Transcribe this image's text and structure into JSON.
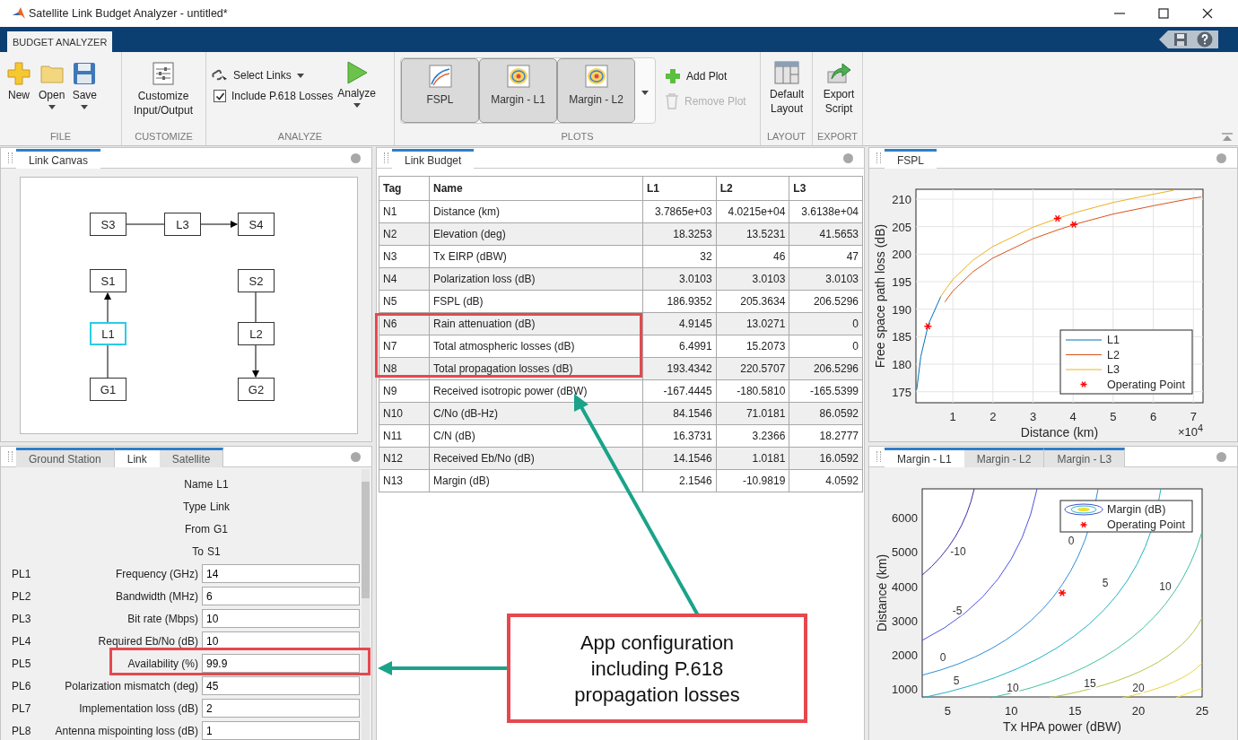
{
  "window": {
    "title": "Satellite Link Budget Analyzer - untitled*"
  },
  "ribbon_tabs": [
    {
      "label": "BUDGET ANALYZER",
      "selected": true
    }
  ],
  "toolstrip": {
    "file": {
      "label": "FILE",
      "buttons": [
        {
          "label": "New",
          "kind": "new",
          "caret": false
        },
        {
          "label": "Open",
          "kind": "open",
          "caret": true
        },
        {
          "label": "Save",
          "kind": "save",
          "caret": true
        }
      ]
    },
    "customize": {
      "label": "CUSTOMIZE",
      "button": "Customize Input/Output"
    },
    "analyze": {
      "label": "ANALYZE",
      "select_links": "Select Links",
      "include_p618": {
        "label": "Include P.618 Losses",
        "checked": true
      },
      "analyze_button": "Analyze"
    },
    "plots": {
      "label": "PLOTS",
      "gallery": [
        {
          "label": "FSPL",
          "kind": "fspl"
        },
        {
          "label": "Margin - L1",
          "kind": "margin"
        },
        {
          "label": "Margin - L2",
          "kind": "margin"
        }
      ],
      "add_plot": {
        "label": "Add Plot",
        "disabled": false
      },
      "remove_plot": {
        "label": "Remove Plot",
        "disabled": true
      }
    },
    "layout": {
      "label": "LAYOUT",
      "button": "Default Layout"
    },
    "export": {
      "label": "EXPORT",
      "button": "Export Script"
    }
  },
  "link_canvas": {
    "tab": "Link Canvas",
    "nodes": [
      {
        "label": "S3",
        "selected": false
      },
      {
        "label": "L3",
        "selected": false
      },
      {
        "label": "S4",
        "selected": false
      },
      {
        "label": "S1",
        "selected": false
      },
      {
        "label": "S2",
        "selected": false
      },
      {
        "label": "L1",
        "selected": true
      },
      {
        "label": "L2",
        "selected": false
      },
      {
        "label": "G1",
        "selected": false
      },
      {
        "label": "G2",
        "selected": false
      }
    ]
  },
  "properties": {
    "tabs": [
      {
        "label": "Ground Station",
        "selected": false
      },
      {
        "label": "Link",
        "selected": true
      },
      {
        "label": "Satellite",
        "selected": false
      }
    ],
    "info": [
      {
        "label": "Name",
        "value": "L1"
      },
      {
        "label": "Type",
        "value": "Link"
      },
      {
        "label": "From",
        "value": "G1"
      },
      {
        "label": "To",
        "value": "S1"
      }
    ],
    "params": [
      {
        "tag": "PL1",
        "label": "Frequency (GHz)",
        "value": "14"
      },
      {
        "tag": "PL2",
        "label": "Bandwidth (MHz)",
        "value": "6"
      },
      {
        "tag": "PL3",
        "label": "Bit rate (Mbps)",
        "value": "10"
      },
      {
        "tag": "PL4",
        "label": "Required Eb/No (dB)",
        "value": "10"
      },
      {
        "tag": "PL5",
        "label": "Availability (%)",
        "value": "99.9"
      },
      {
        "tag": "PL6",
        "label": "Polarization mismatch (deg)",
        "value": "45"
      },
      {
        "tag": "PL7",
        "label": "Implementation loss (dB)",
        "value": "2"
      },
      {
        "tag": "PL8",
        "label": "Antenna mispointing loss (dB)",
        "value": "1"
      }
    ]
  },
  "link_budget": {
    "tab": "Link Budget",
    "columns": [
      "Tag",
      "Name",
      "L1",
      "L2",
      "L3"
    ],
    "rows": [
      [
        "N1",
        "Distance (km)",
        "3.7865e+03",
        "4.0215e+04",
        "3.6138e+04"
      ],
      [
        "N2",
        "Elevation (deg)",
        "18.3253",
        "13.5231",
        "41.5653"
      ],
      [
        "N3",
        "Tx EIRP (dBW)",
        "32",
        "46",
        "47"
      ],
      [
        "N4",
        "Polarization loss (dB)",
        "3.0103",
        "3.0103",
        "3.0103"
      ],
      [
        "N5",
        "FSPL (dB)",
        "186.9352",
        "205.3634",
        "206.5296"
      ],
      [
        "N6",
        "Rain attenuation (dB)",
        "4.9145",
        "13.0271",
        "0"
      ],
      [
        "N7",
        "Total atmospheric losses (dB)",
        "6.4991",
        "15.2073",
        "0"
      ],
      [
        "N8",
        "Total propagation losses (dB)",
        "193.4342",
        "220.5707",
        "206.5296"
      ],
      [
        "N9",
        "Received isotropic power (dBW)",
        "-167.4445",
        "-180.5810",
        "-165.5399"
      ],
      [
        "N10",
        "C/No (dB-Hz)",
        "84.1546",
        "71.0181",
        "86.0592"
      ],
      [
        "N11",
        "C/N (dB)",
        "16.3731",
        "3.2366",
        "18.2777"
      ],
      [
        "N12",
        "Received Eb/No (dB)",
        "14.1546",
        "1.0181",
        "16.0592"
      ],
      [
        "N13",
        "Margin (dB)",
        "2.1546",
        "-10.9819",
        "4.0592"
      ]
    ]
  },
  "fspl_plot": {
    "tab": "FSPL",
    "x_exponent": "×10$^{4}$",
    "chart_data": {
      "type": "line",
      "xlabel": "Distance (km)",
      "ylabel": "Free space path loss (dB)",
      "x": [
        0.1,
        0.2,
        0.379,
        0.4,
        0.7,
        0.8,
        1,
        1.5,
        2,
        3,
        3.61,
        4,
        4.02,
        5,
        6,
        6.5,
        7,
        7.2
      ],
      "series": [
        {
          "name": "L1",
          "color": "#0072bd",
          "values": [
            175.4,
            181.4,
            186.9,
            187.4,
            192.3,
            null,
            null,
            null,
            null,
            null,
            null,
            null,
            null,
            null,
            null,
            null,
            null,
            null
          ]
        },
        {
          "name": "L2",
          "color": "#d95319",
          "values": [
            null,
            null,
            null,
            null,
            null,
            191.3,
            193.3,
            196.8,
            199.3,
            202.8,
            204.4,
            205.3,
            205.4,
            207.3,
            208.8,
            209.5,
            210.2,
            210.4
          ]
        },
        {
          "name": "L3",
          "color": "#edb120",
          "values": [
            null,
            null,
            null,
            null,
            192.3,
            193.4,
            195.4,
            198.9,
            201.4,
            204.9,
            206.5,
            207.4,
            207.5,
            209.4,
            210.9,
            211.6,
            null,
            null
          ]
        },
        {
          "name": "Operating Point",
          "color": "#ff0000",
          "marker": "cross",
          "values": [
            null,
            null,
            186.9,
            null,
            null,
            null,
            null,
            null,
            null,
            null,
            206.5,
            null,
            205.4,
            null,
            null,
            null,
            null,
            null
          ]
        }
      ],
      "grid": true,
      "legend": "lower right",
      "xlim": [
        0.08,
        7.24
      ],
      "ylim": [
        173,
        211.8
      ],
      "xticks": [
        1,
        2,
        3,
        4,
        5,
        6,
        7
      ],
      "yticks": [
        175,
        180,
        185,
        190,
        195,
        200,
        205,
        210
      ]
    }
  },
  "margin_plot": {
    "tabs": [
      {
        "label": "Margin - L1",
        "selected": true
      },
      {
        "label": "Margin - L2",
        "selected": false
      },
      {
        "label": "Margin - L3",
        "selected": false
      }
    ],
    "xlabel": "Tx HPA power (dBW)",
    "ylabel": "Distance (km)",
    "xticks": [
      "5",
      "10",
      "15",
      "20",
      "25"
    ],
    "yticks": [
      "6000",
      "5000",
      "4000",
      "3000",
      "2000",
      "1000"
    ],
    "legend": [
      {
        "label": "Margin (dB)",
        "kind": "contour"
      },
      {
        "label": "Operating Point",
        "kind": "marker"
      }
    ],
    "contour_labels": [
      "-10",
      "-5",
      "0",
      "0",
      "5",
      "5",
      "10",
      "10",
      "15",
      "20"
    ]
  },
  "callout": "App configuration including P.618 propagation losses"
}
